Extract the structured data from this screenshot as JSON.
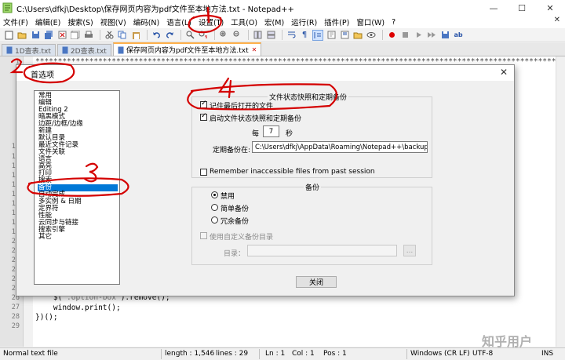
{
  "window": {
    "title": "C:\\Users\\dfkj\\Desktop\\保存网页内容为pdf文件至本地方法.txt - Notepad++",
    "minimize_glyph": "—",
    "maximize_glyph": "☐",
    "close_glyph": "✕"
  },
  "menu": {
    "items": [
      "文件(F)",
      "编辑(E)",
      "搜索(S)",
      "视图(V)",
      "编码(N)",
      "语言(L)",
      "设置(T)",
      "工具(O)",
      "宏(M)",
      "运行(R)",
      "插件(P)",
      "窗口(W)",
      "?"
    ],
    "close_glyph": "✕"
  },
  "tabs": [
    {
      "label": "1D查表.txt",
      "active": false
    },
    {
      "label": "2D查表.txt",
      "active": false
    },
    {
      "label": "保存网页内容为pdf文件至本地方法.txt",
      "active": true
    }
  ],
  "editor": {
    "line_numbers": [
      "1",
      "2",
      "3",
      "4",
      "5",
      "6",
      "7",
      "8",
      "9",
      "10",
      "11",
      "12",
      "13",
      "14",
      "15",
      "16",
      "17",
      "18",
      "19",
      "20",
      "21",
      "22",
      "23",
      "24",
      "25",
      "26",
      "27",
      "28",
      "29"
    ],
    "first_line_text": "****************************************************************************************************************************",
    "code": {
      "l26_a": "    $(",
      "l26_str": "\".option-box\"",
      "l26_b": ").remove();",
      "l27": "    window.print();",
      "l28": "})();"
    }
  },
  "dialog": {
    "title": "首选项",
    "categories": [
      "常用",
      "编辑",
      "Editing 2",
      "暗黑模式",
      "边距/边框/边缘",
      "新建",
      "默认目录",
      "最近文件记录",
      "文件关联",
      "语言",
      "高亮",
      "打印",
      "搜索",
      "备份",
      "自动完成",
      "多实例 & 日期",
      "定界符",
      "性能",
      "云同步与链接",
      "搜索引擎",
      "其它"
    ],
    "selected_category": "备份",
    "snapshot_group": {
      "title": "文件状态快照和定期备份",
      "remember_last_session": {
        "label": "记住最后打开的文件",
        "checked": true
      },
      "enable_snapshot": {
        "label": "启动文件状态快照和定期备份",
        "checked": true
      },
      "every_label": "每",
      "every_value": "7",
      "seconds_label": "秒",
      "backup_path_label": "定期备份在:",
      "backup_path_value": "C:\\Users\\dfkj\\AppData\\Roaming\\Notepad++\\backup\\",
      "remember_inaccessible": {
        "label": "Remember inaccessible files from past session",
        "checked": false
      }
    },
    "backup_group": {
      "title": "备份",
      "options": [
        "禁用",
        "简单备份",
        "冗余备份"
      ],
      "selected": "禁用",
      "custom_dir": {
        "label": "使用自定义备份目录",
        "checked": false
      },
      "dir_label": "目录：",
      "dir_value": "",
      "browse_label": "..."
    },
    "close_button": "关闭"
  },
  "status": {
    "file_type": "Normal text file",
    "length": "length : 1,546",
    "lines": "lines : 29",
    "ln": "Ln : 1",
    "col": "Col : 1",
    "pos": "Pos : 1",
    "eol": "Windows (CR LF)",
    "encoding": "UTF-8",
    "mode": "INS"
  },
  "annotations": {
    "step1": "1",
    "step2": "2",
    "step3": "3",
    "step4": "4",
    "color": "#d40000"
  },
  "watermark": "知乎用户",
  "colors": {
    "selection": "#0078d7",
    "active_tab_accent": "#ffb14b"
  }
}
